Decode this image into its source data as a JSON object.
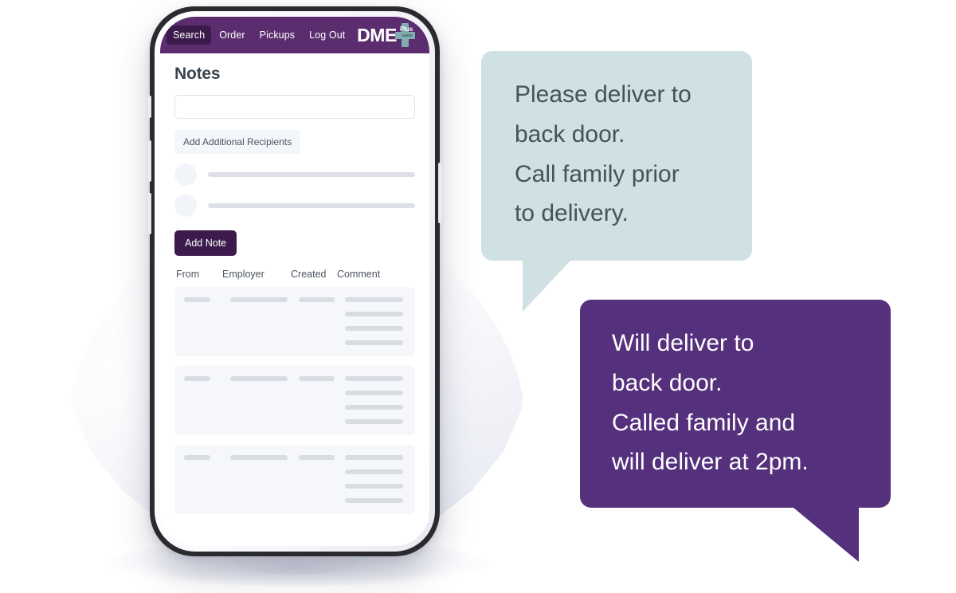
{
  "app": {
    "nav": {
      "items": [
        {
          "label": "Search",
          "active": true
        },
        {
          "label": "Order",
          "active": false
        },
        {
          "label": "Pickups",
          "active": false
        },
        {
          "label": "Log Out",
          "active": false
        }
      ],
      "logo": {
        "wordmark": "DME",
        "plus_word": "Plus",
        "plus_sub": "Mobile",
        "icon": "plus-icon",
        "accent_color": "#7fadb0",
        "bar_color": "#5b2d6e"
      }
    },
    "page_title": "Notes",
    "note_input": {
      "value": "",
      "placeholder": ""
    },
    "add_recipients_label": "Add Additional Recipients",
    "add_note_label": "Add Note",
    "recipient_placeholders": [
      {
        "avatar": "avatar-placeholder"
      },
      {
        "avatar": "avatar-placeholder"
      }
    ],
    "table": {
      "columns": [
        "From",
        "Employer",
        "Created",
        "Comment"
      ],
      "rows": [
        {
          "from": "",
          "employer": "",
          "created": "",
          "comment_lines": 4
        },
        {
          "from": "",
          "employer": "",
          "created": "",
          "comment_lines": 4
        },
        {
          "from": "",
          "employer": "",
          "created": "",
          "comment_lines": 4
        }
      ]
    }
  },
  "bubbles": {
    "incoming": {
      "text": "Please deliver to\nback door.\nCall family prior\nto delivery.",
      "background": "#cfe1e2",
      "text_color": "#46525c"
    },
    "outgoing": {
      "text": "Will deliver to\nback door.\nCalled family and\nwill deliver at 2pm.",
      "background": "#55307c",
      "text_color": "#ffffff"
    }
  }
}
